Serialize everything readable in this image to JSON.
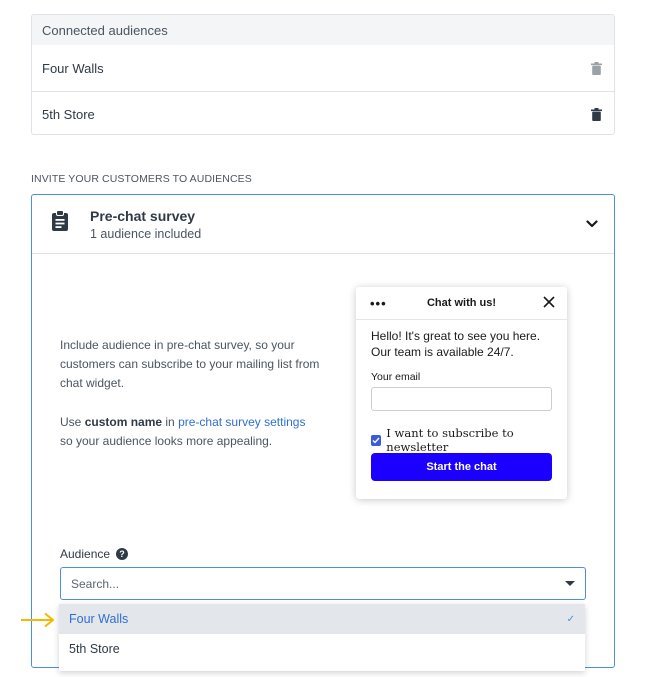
{
  "connected": {
    "header": "Connected audiences",
    "rows": [
      {
        "name": "Four Walls",
        "icon": "trash-icon"
      },
      {
        "name": "5th Store",
        "icon": "trash-icon"
      }
    ]
  },
  "invite_label": "INVITE YOUR CUSTOMERS TO AUDIENCES",
  "panel": {
    "title": "Pre-chat survey",
    "subtitle": "1 audience included",
    "desc1": "Include audience in pre-chat survey, so your customers can subscribe to your mailing list from chat widget.",
    "desc2_prefix": "Use ",
    "desc2_bold": "custom name",
    "desc2_mid": " in ",
    "desc2_link": "pre-chat survey settings",
    "desc2_suffix": " so your audience looks more appealing."
  },
  "chat": {
    "dots": "•••",
    "title": "Chat with us!",
    "hello": "Hello! It's great to see you here. Our team is available 24/7.",
    "email_label": "Your email",
    "email_value": "",
    "checkbox_label": "I want to subscribe to newsletter",
    "checkbox_checked": true,
    "button": "Start the chat",
    "button_color": "#1b00ff"
  },
  "audience": {
    "label": "Audience",
    "help": "?",
    "placeholder": "Search...",
    "options": [
      {
        "label": "Four Walls",
        "selected": true
      },
      {
        "label": "5th Store",
        "selected": false
      }
    ]
  },
  "colors": {
    "accent": "#4a8fe0",
    "link": "#2f6fd1",
    "arrow": "#f5b800"
  }
}
